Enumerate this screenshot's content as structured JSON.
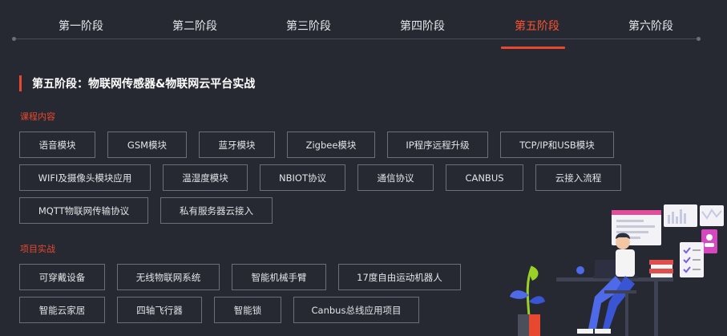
{
  "tabs": [
    {
      "label": "第一阶段",
      "active": false
    },
    {
      "label": "第二阶段",
      "active": false
    },
    {
      "label": "第三阶段",
      "active": false
    },
    {
      "label": "第四阶段",
      "active": false
    },
    {
      "label": "第五阶段",
      "active": true
    },
    {
      "label": "第六阶段",
      "active": false
    }
  ],
  "heading": "第五阶段：物联网传感器&物联网云平台实战",
  "course": {
    "label": "课程内容",
    "rows": [
      [
        "语音模块",
        "GSM模块",
        "蓝牙模块",
        "Zigbee模块",
        "IP程序远程升级",
        "TCP/IP和USB模块"
      ],
      [
        "WIFI及摄像头模块应用",
        "温湿度模块",
        "NBIOT协议",
        "通信协议",
        "CANBUS",
        "云接入流程"
      ],
      [
        "MQTT物联网传输协议",
        "私有服务器云接入"
      ]
    ]
  },
  "projects": {
    "label": "项目实战",
    "rows": [
      [
        "可穿戴设备",
        "无线物联网系统",
        "智能机械手臂",
        "17度自由运动机器人"
      ],
      [
        "智能云家居",
        "四轴飞行器",
        "智能锁",
        "Canbus总线应用项目"
      ]
    ]
  },
  "colors": {
    "accent": "#e8482f",
    "background": "#262931",
    "tag_border": "#6b6f79"
  }
}
